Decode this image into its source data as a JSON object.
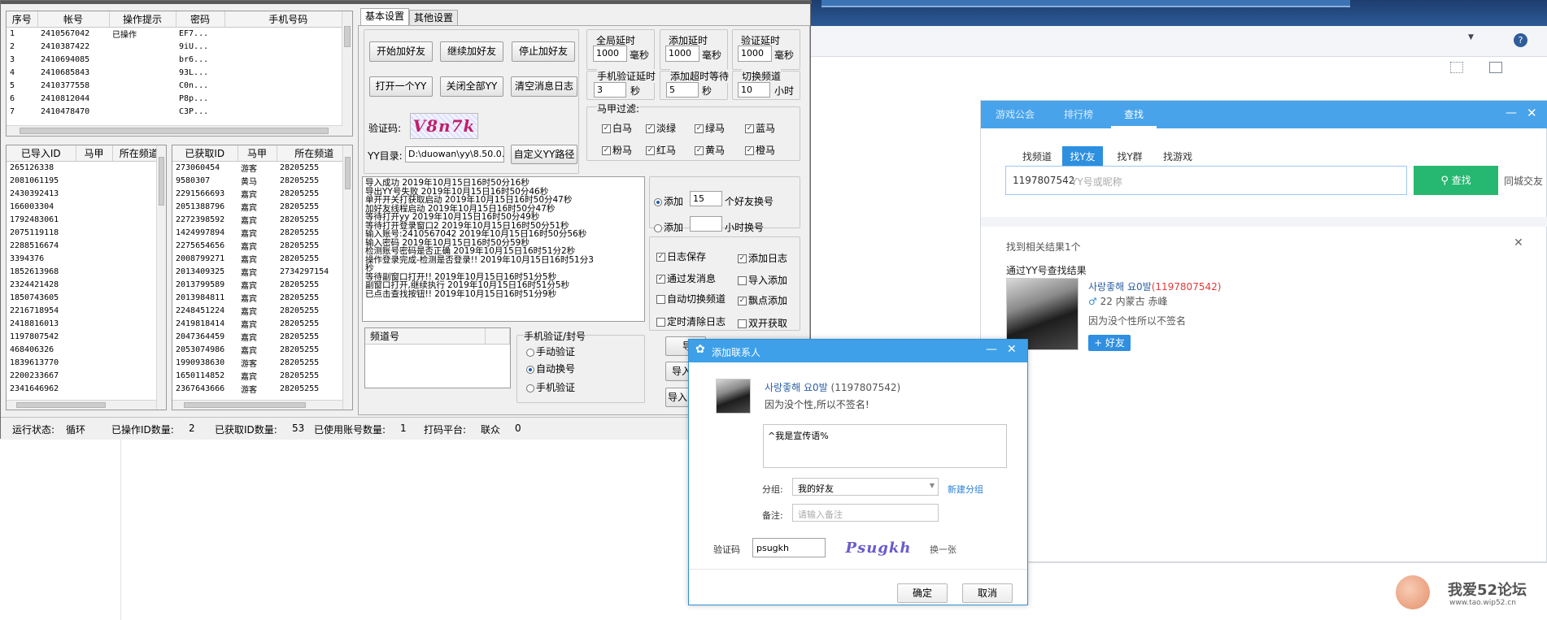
{
  "tool": {
    "accounts": {
      "headers": [
        "序号",
        "帐号",
        "操作提示",
        "密码",
        "手机号码"
      ],
      "rows": [
        [
          "1",
          "2410567042",
          "已操作",
          "EF7..."
        ],
        [
          "2",
          "2410387422",
          "",
          "9iU..."
        ],
        [
          "3",
          "2410694085",
          "",
          "br6..."
        ],
        [
          "4",
          "2410685843",
          "",
          "93L..."
        ],
        [
          "5",
          "2410377558",
          "",
          "C0n..."
        ],
        [
          "6",
          "2410812044",
          "",
          "P8p..."
        ],
        [
          "7",
          "2410478470",
          "",
          "C3P..."
        ]
      ]
    },
    "imported": {
      "headers": [
        "已导入ID",
        "马甲",
        "所在频道"
      ],
      "ids": [
        "265126338",
        "2081061195",
        "2430392413",
        "166003304",
        "1792483061",
        "2075119118",
        "2288516674",
        "3394376",
        "1852613968",
        "2324421428",
        "1850743605",
        "2216718954",
        "2418816013",
        "1197807542",
        "468406326",
        "1839613770",
        "2200233667",
        "2341646962"
      ]
    },
    "fetched": {
      "headers": [
        "已获取ID",
        "马甲",
        "所在频道"
      ],
      "rows": [
        [
          "273060454",
          "游客",
          "28205255"
        ],
        [
          "9580307",
          "黄马",
          "28205255"
        ],
        [
          "2291566693",
          "嘉宾",
          "28205255"
        ],
        [
          "2051388796",
          "嘉宾",
          "28205255"
        ],
        [
          "2272398592",
          "嘉宾",
          "28205255"
        ],
        [
          "1424997894",
          "嘉宾",
          "28205255"
        ],
        [
          "2275654656",
          "嘉宾",
          "28205255"
        ],
        [
          "2008799271",
          "嘉宾",
          "28205255"
        ],
        [
          "2013409325",
          "嘉宾",
          "2734297154"
        ],
        [
          "2013799589",
          "嘉宾",
          "28205255"
        ],
        [
          "2013984811",
          "嘉宾",
          "28205255"
        ],
        [
          "2248451224",
          "嘉宾",
          "28205255"
        ],
        [
          "2419818414",
          "嘉宾",
          "28205255"
        ],
        [
          "2047364459",
          "嘉宾",
          "28205255"
        ],
        [
          "2053074986",
          "嘉宾",
          "28205255"
        ],
        [
          "1990938630",
          "游客",
          "28205255"
        ],
        [
          "1650114852",
          "嘉宾",
          "28205255"
        ],
        [
          "2367643666",
          "游客",
          "28205255"
        ]
      ]
    },
    "tabs": [
      "基本设置",
      "其他设置"
    ],
    "buttons": {
      "start": "开始加好友",
      "continue": "继续加好友",
      "stop": "停止加好友",
      "open_yy": "打开一个YY",
      "close_all": "关闭全部YY",
      "clear_log": "清空消息日志",
      "custom_path": "自定义YY路径"
    },
    "captcha_label": "验证码:",
    "captcha_text": "V8n7k",
    "yy_dir_label": "YY目录:",
    "yy_dir_value": "D:\\duowan\\yy\\8.50.0.",
    "delays": {
      "global_label": "全局延时",
      "global_value": "1000",
      "add_label": "添加延时",
      "add_value": "1000",
      "verify_label": "验证延时",
      "verify_value": "1000",
      "ms": "毫秒",
      "phone_label": "手机验证延时",
      "phone_value": "3",
      "timeout_label": "添加超时等待",
      "timeout_value": "5",
      "sec": "秒",
      "switch_label": "切换频道",
      "switch_value": "10",
      "hour": "小时"
    },
    "filter_label": "马甲过滤:",
    "filters": [
      "白马",
      "淡绿",
      "绿马",
      "蓝马",
      "粉马",
      "红马",
      "黄马",
      "橙马"
    ],
    "log": [
      "导入成功      2019年10月15日16时50分16秒",
      "导出YY号失败      2019年10月15日16时50分46秒",
      "单开开关打获取启动      2019年10月15日16时50分47秒",
      "加好友线程启动      2019年10月15日16时50分47秒",
      "等待打开yy      2019年10月15日16时50分49秒",
      "等待打开登录窗口2      2019年10月15日16时50分51秒",
      "输入账号:2410567042      2019年10月15日16时50分56秒",
      "输入密码      2019年10月15日16时50分59秒",
      "检测账号密码是否正确      2019年10月15日16时51分2秒",
      "操作登录完成-检测是否登录!!      2019年10月15日16时51分3",
      "秒",
      "等待副窗口打开!!      2019年10月15日16时51分5秒",
      "副窗口打开,继续执行      2019年10月15日16时51分5秒",
      "已点击查找按钮!!      2019年10月15日16时51分9秒"
    ],
    "opt": {
      "add1": "添加",
      "add1_value": "15",
      "add1_suffix": "个好友换号",
      "add2": "添加",
      "add2_suffix": "小时换号",
      "log_save": "日志保存",
      "add_log": "添加日志",
      "send_msg": "通过发消息",
      "import_add": "导入添加",
      "auto_switch": "自动切换频道",
      "float_add": "飘点添加",
      "timed_clear": "定时清除日志",
      "double_fetch": "双开获取"
    },
    "channel_header": "频道号",
    "phone_group": "手机验证/封号",
    "phone_opts": [
      "手动验证",
      "自动换号",
      "手机验证"
    ],
    "side_buttons": [
      "导",
      "导入",
      "导入"
    ],
    "status": {
      "run_label": "运行状态:",
      "run_value": "循环",
      "op_label": "已操作ID数量:",
      "op_value": "2",
      "got_label": "已获取ID数量:",
      "got_value": "53",
      "used_label": "已使用账号数量:",
      "used_value": "1",
      "platform_label": "打码平台:",
      "platform_value": "联众",
      "platform_count": "0"
    }
  },
  "yy": {
    "top_tabs": [
      "游戏公会",
      "排行榜",
      "查找"
    ],
    "search_tabs": [
      "找频道",
      "找Y友",
      "找Y群",
      "找游戏"
    ],
    "search_value": "1197807542",
    "search_placeholder": "YY号或昵称",
    "search_button": "查找",
    "city_friend": "同城交友",
    "result_count": "找到相关结果1个",
    "result_title": "通过YY号查找结果",
    "user_name": "사랑좋해 요0발",
    "user_id": "(1197807542)",
    "user_meta": "22  内蒙古 赤峰",
    "user_sign": "因为没个性所以不签名",
    "add_friend": "+ 好友"
  },
  "dialog": {
    "title": "添加联系人",
    "name": "사랑좋해 요0발",
    "id": "(1197807542)",
    "sign": "因为没个性,所以不签名!",
    "message": "^我是宣传语%",
    "group_label": "分组:",
    "group_value": "我的好友",
    "new_group": "新建分组",
    "note_label": "备注:",
    "note_placeholder": "请输入备注",
    "captcha_label": "验证码",
    "captcha_value": "psugkh",
    "captcha_image_text": "Psugkh",
    "refresh": "换一张",
    "ok": "确定",
    "cancel": "取消"
  },
  "watermark": {
    "text": "我爱52论坛",
    "url": "www.tao.wip52.cn"
  },
  "colors": {
    "yy_blue": "#48a3ea",
    "search_green": "#26b870",
    "id_red": "#e03a3a",
    "link_blue": "#2a7fd4"
  }
}
